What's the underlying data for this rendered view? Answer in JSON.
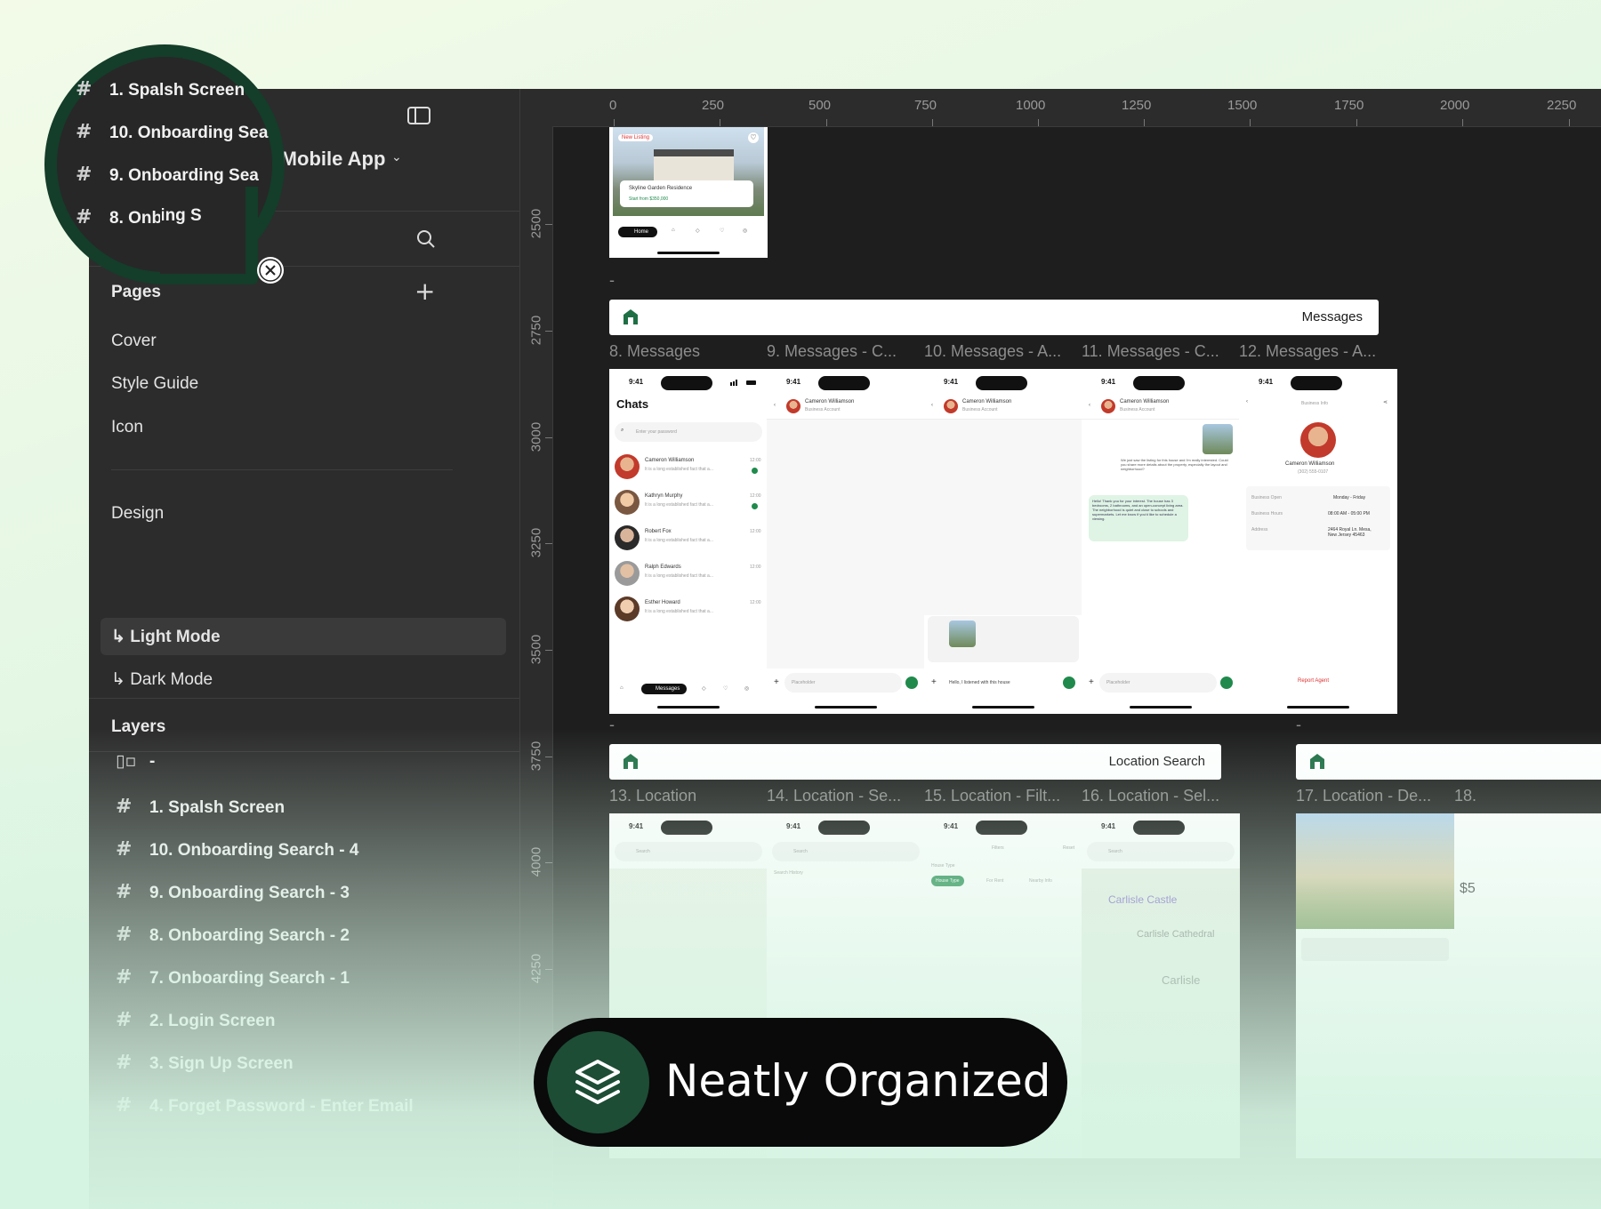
{
  "header": {
    "project_title_partial": "te Mobile App"
  },
  "sidebar": {
    "pages_heading": "Pages",
    "pages": [
      "Cover",
      "Style Guide",
      "Icon"
    ],
    "design_heading": "Design",
    "modes": [
      "↳ Light Mode",
      "↳ Dark Mode"
    ],
    "active_mode": "↳ Light Mode",
    "layers_heading": "Layers",
    "layer_group": "-",
    "layers": [
      "1. Spalsh Screen",
      "10. Onboarding Search - 4",
      "9. Onboarding Search - 3",
      "8. Onboarding Search - 2",
      "7. Onboarding Search - 1",
      "2. Login Screen",
      "3. Sign Up Screen",
      "4. Forget Password - Enter Email"
    ]
  },
  "magnifier": {
    "rows": [
      "1. Spalsh Screen",
      "10. Onboarding Sea",
      "9. Onboarding Sea",
      "8. Onboarding S"
    ]
  },
  "ruler": {
    "top": [
      "0",
      "250",
      "500",
      "750",
      "1000",
      "1250",
      "1500",
      "1750",
      "2000",
      "2250"
    ],
    "left": [
      "2500",
      "2750",
      "3000",
      "3250",
      "3500",
      "3750",
      "4000",
      "4250"
    ]
  },
  "canvas": {
    "top_card": {
      "badge": "New Listing",
      "title": "Skyline Garden Residence",
      "price": "Start from $350,000",
      "nav_home": "Home"
    },
    "dash_1": "-",
    "dash_2": "-",
    "dash_3": "-",
    "messages_section": "Messages",
    "message_frames": [
      "8. Messages",
      "9. Messages - C...",
      "10. Messages - A...",
      "11. Messages - C...",
      "12. Messages - A..."
    ],
    "location_section": "Location Search",
    "location_frames": [
      "13. Location",
      "14. Location - Se...",
      "15. Location - Filt...",
      "16. Location - Sel...",
      "17. Location - De...",
      "18."
    ],
    "phone_time": "9:41",
    "chats": {
      "title": "Chats",
      "search_placeholder": "Enter your password",
      "preview": "It is a long established fact that a...",
      "items": [
        {
          "name": "Cameron Williamson",
          "time": "12:00"
        },
        {
          "name": "Kathryn Murphy",
          "time": "12:00"
        },
        {
          "name": "Robert Fox",
          "time": "12:00"
        },
        {
          "name": "Ralph Edwards",
          "time": "12:00"
        },
        {
          "name": "Esther Howard",
          "time": "12:00"
        }
      ],
      "nav_messages": "Messages"
    },
    "contact": {
      "name": "Cameron Williamson",
      "role": "Business Account"
    },
    "input_placeholder": "Placeholder",
    "reply_text": "Hello, I listened with this house",
    "chat11_user_msg": "We just saw the listing for this house and I'm really interested. Could you share more details about the property, especially the layout and neighborhood?",
    "chat11_reply": "Hello! Thank you for your interest. The house has 3 bedrooms, 2 bathrooms, and an open-concept living area. The neighborhood is quiet and close to schools and supermarkets. Let me know if you'd like to schedule a viewing.",
    "business": {
      "header": "Business Info",
      "name": "Cameron Williamson",
      "phone": "(302) 555-0107",
      "open_label": "Business Open",
      "open_value": "Monday - Friday",
      "hours_label": "Business Hours",
      "hours_value": "08:00 AM - 05:00 PM",
      "address_label": "Address",
      "address_value": "2464 Royal Ln. Mesa, New Jersey 45463",
      "report": "Report Agent"
    },
    "location": {
      "search": "Search",
      "filters": "Filters",
      "reset": "Reset",
      "house_type": "House Type",
      "chip_1": "House Type",
      "chip_2": "For Rent",
      "chip_3": "Nearby Info",
      "history": "Search History",
      "place_1": "Carlisle Castle",
      "place_2": "Carlisle Cathedral",
      "city": "Carlisle",
      "price_partial": "$5"
    }
  },
  "badge": {
    "text": "Neatly Organized"
  },
  "colors": {
    "accent": "#1f8a4c",
    "canvas_bg": "#1e1e1e",
    "panel_bg": "#2c2c2c",
    "badge_icon_bg": "#1d4d35"
  }
}
